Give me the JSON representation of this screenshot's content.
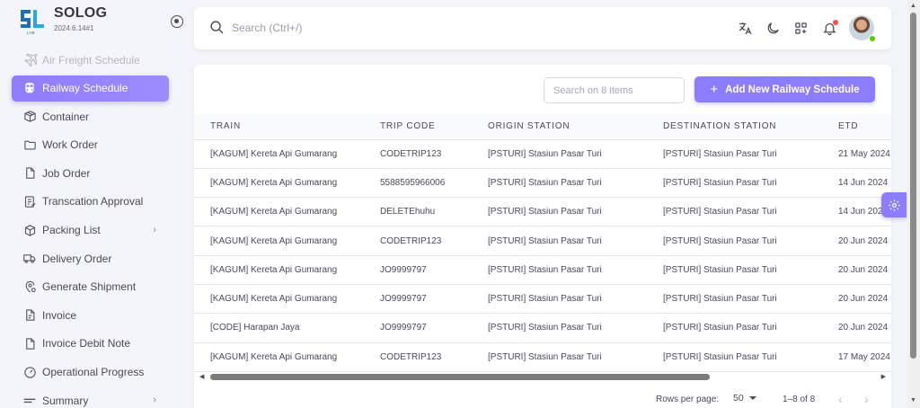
{
  "brand": {
    "name": "SOLOG",
    "version": "2024.6.14#1",
    "logo_text": "SL",
    "logo_subtext": "LAB"
  },
  "sidebar": {
    "items": [
      {
        "label": "Air Freight Schedule",
        "icon": "airplane-icon"
      },
      {
        "label": "Railway Schedule",
        "icon": "train-icon"
      },
      {
        "label": "Container",
        "icon": "box-icon"
      },
      {
        "label": "Work Order",
        "icon": "folder-icon"
      },
      {
        "label": "Job Order",
        "icon": "file-icon"
      },
      {
        "label": "Transcation Approval",
        "icon": "checklist-icon"
      },
      {
        "label": "Packing List",
        "icon": "package-icon"
      },
      {
        "label": "Delivery Order",
        "icon": "truck-icon"
      },
      {
        "label": "Generate Shipment",
        "icon": "location-gear-icon"
      },
      {
        "label": "Invoice",
        "icon": "invoice-icon"
      },
      {
        "label": "Invoice Debit Note",
        "icon": "document-icon"
      },
      {
        "label": "Operational Progress",
        "icon": "gauge-icon"
      },
      {
        "label": "Summary",
        "icon": "menu-icon"
      }
    ]
  },
  "header": {
    "search_placeholder": "Search (Ctrl+/)",
    "icons": [
      "translate-icon",
      "moon-icon",
      "apps-add-icon",
      "bell-icon",
      "user-avatar"
    ]
  },
  "toolbar": {
    "filter_placeholder": "Search on 8 items",
    "add_label": "Add New Railway Schedule"
  },
  "table": {
    "columns": [
      "TRAIN",
      "TRIP CODE",
      "ORIGIN STATION",
      "DESTINATION STATION",
      "ETD"
    ],
    "rows": [
      [
        "[KAGUM] Kereta Api Gumarang",
        "CODETRIP123",
        "[PSTURI] Stasiun Pasar Turi",
        "[PSTURI] Stasiun Pasar Turi",
        "21 May 2024"
      ],
      [
        "[KAGUM] Kereta Api Gumarang",
        "5588595966006",
        "[PSTURI] Stasiun Pasar Turi",
        "[PSTURI] Stasiun Pasar Turi",
        "14 Jun 2024"
      ],
      [
        "[KAGUM] Kereta Api Gumarang",
        "DELETEhuhu",
        "[PSTURI] Stasiun Pasar Turi",
        "[PSTURI] Stasiun Pasar Turi",
        "14 Jun 2024"
      ],
      [
        "[KAGUM] Kereta Api Gumarang",
        "CODETRIP123",
        "[PSTURI] Stasiun Pasar Turi",
        "[PSTURI] Stasiun Pasar Turi",
        "20 Jun 2024"
      ],
      [
        "[KAGUM] Kereta Api Gumarang",
        "JO9999797",
        "[PSTURI] Stasiun Pasar Turi",
        "[PSTURI] Stasiun Pasar Turi",
        "20 Jun 2024"
      ],
      [
        "[KAGUM] Kereta Api Gumarang",
        "JO9999797",
        "[PSTURI] Stasiun Pasar Turi",
        "[PSTURI] Stasiun Pasar Turi",
        "20 Jun 2024"
      ],
      [
        "[CODE] Harapan Jaya",
        "JO9999797",
        "[PSTURI] Stasiun Pasar Turi",
        "[PSTURI] Stasiun Pasar Turi",
        "20 Jun 2024"
      ],
      [
        "[KAGUM] Kereta Api Gumarang",
        "CODETRIP123",
        "[PSTURI] Stasiun Pasar Turi",
        "[PSTURI] Stasiun Pasar Turi",
        "17 May 2024"
      ]
    ]
  },
  "pagination": {
    "rows_per_page_label": "Rows per page:",
    "rows_per_page_value": "50",
    "range": "1–8 of 8"
  },
  "colors": {
    "accent": "#8c7cff",
    "text": "#3a3541",
    "background": "#f4f5fa",
    "notification": "#ff4c51",
    "online": "#56ca00"
  }
}
